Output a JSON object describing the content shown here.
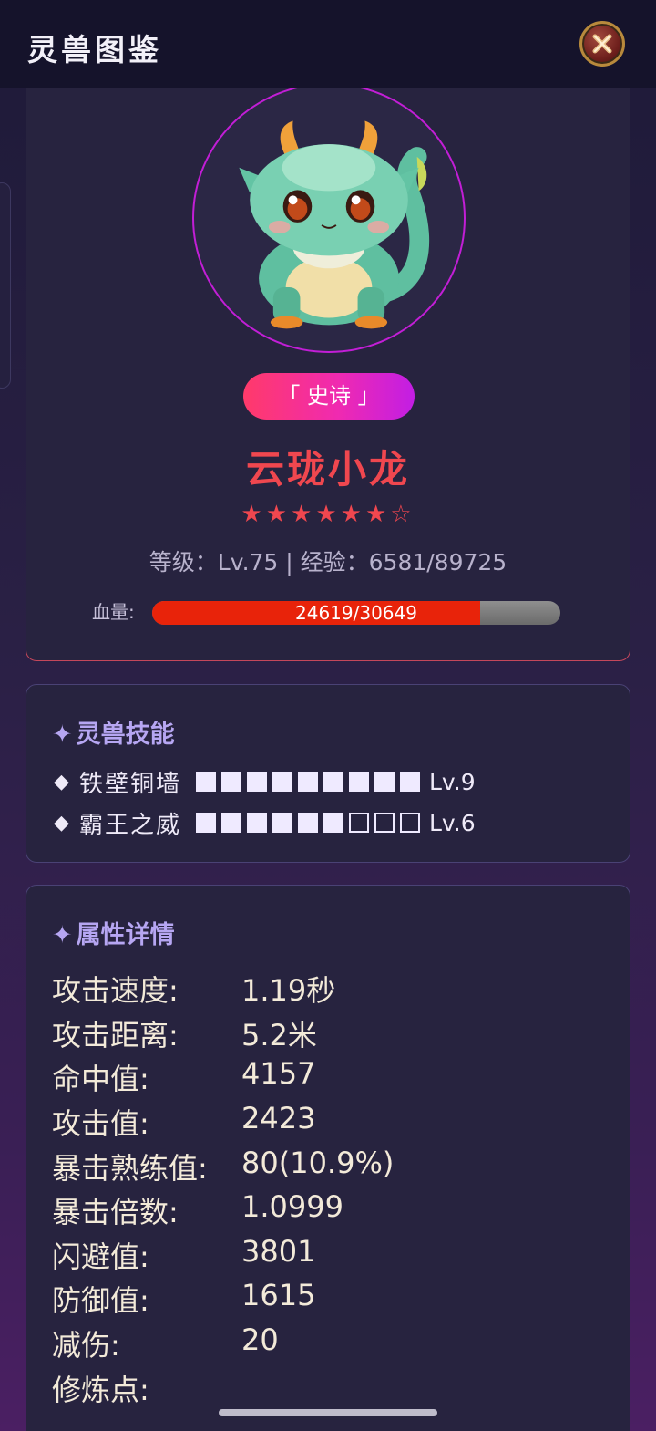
{
  "header": {
    "title": "灵兽图鉴"
  },
  "pet": {
    "rarity": "「 史诗 」",
    "name": "云珑小龙",
    "stars": "★★★★★★☆",
    "star_rating": {
      "filled": 6,
      "total": 7
    },
    "level_line": "等级：Lv.75 | 经验：6581/89725",
    "hp_label": "血量:",
    "hp_text": "24619/30649",
    "hp_current": 24619,
    "hp_max": 30649
  },
  "skills": {
    "title": "灵兽技能",
    "bullet": "◆",
    "items": [
      {
        "name": "铁壁铜墙",
        "level_label": "Lv.9",
        "level": 9,
        "max": 9
      },
      {
        "name": "霸王之威",
        "level_label": "Lv.6",
        "level": 6,
        "max": 9
      }
    ]
  },
  "attributes": {
    "title": "属性详情",
    "rows": [
      {
        "label": "攻击速度:",
        "value": "1.19秒"
      },
      {
        "label": "攻击距离:",
        "value": "5.2米"
      },
      {
        "label": "命中值:",
        "value": "4157"
      },
      {
        "label": "攻击值:",
        "value": "2423"
      },
      {
        "label": "暴击熟练值:",
        "value": "80(10.9%)"
      },
      {
        "label": "暴击倍数:",
        "value": "1.0999"
      },
      {
        "label": "闪避值:",
        "value": "3801"
      },
      {
        "label": "防御值:",
        "value": "1615"
      },
      {
        "label": "减伤:",
        "value": "20"
      },
      {
        "label": "修炼点:",
        "value": ""
      }
    ]
  },
  "colors": {
    "accent_red": "#f0474f",
    "rarity_gradient_start": "#ff3a6a",
    "rarity_gradient_end": "#c21ee4",
    "hp_fill": "#e8230a",
    "section_title": "#b6a6f2"
  },
  "icons": {
    "close": "close-icon",
    "spark": "sparkle-icon",
    "pet_portrait": "dragon-portrait-image"
  }
}
